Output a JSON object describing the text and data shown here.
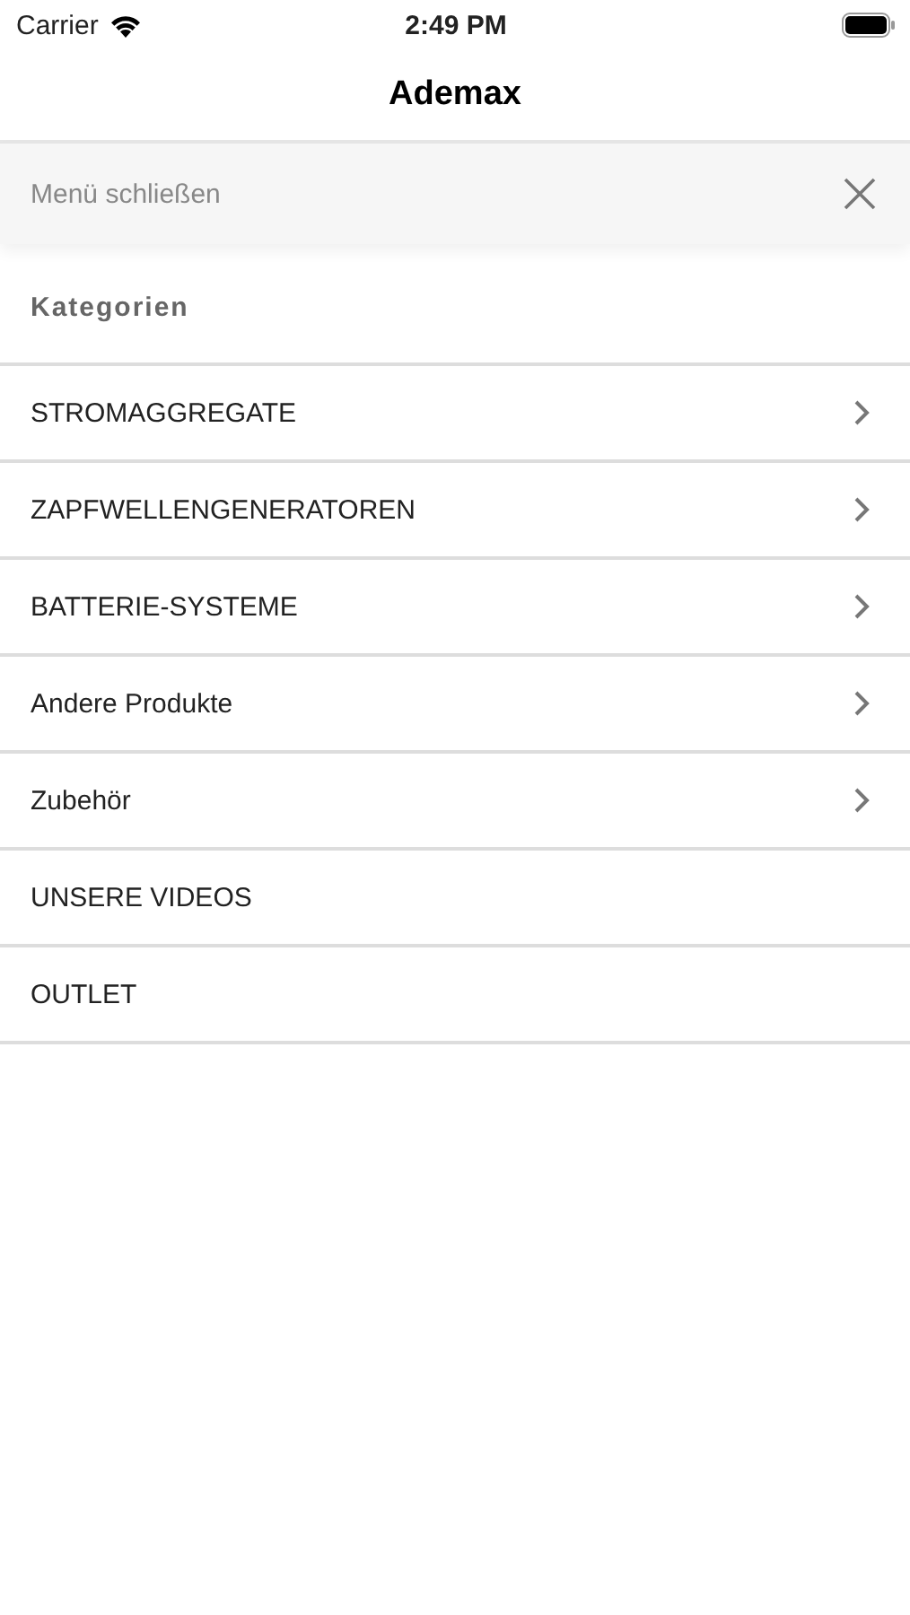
{
  "status_bar": {
    "carrier": "Carrier",
    "time": "2:49 PM"
  },
  "nav_bar": {
    "title": "Ademax"
  },
  "menu_header": {
    "label": "Menü schließen"
  },
  "section": {
    "title": "Kategorien"
  },
  "items": [
    {
      "label": "STROMAGGREGATE",
      "has_submenu": true
    },
    {
      "label": "ZAPFWELLENGENERATOREN",
      "has_submenu": true
    },
    {
      "label": "BATTERIE-SYSTEME",
      "has_submenu": true
    },
    {
      "label": "Andere Produkte",
      "has_submenu": true
    },
    {
      "label": "Zubehör",
      "has_submenu": true
    },
    {
      "label": "UNSERE VIDEOS",
      "has_submenu": false
    },
    {
      "label": "OUTLET",
      "has_submenu": false
    }
  ]
}
